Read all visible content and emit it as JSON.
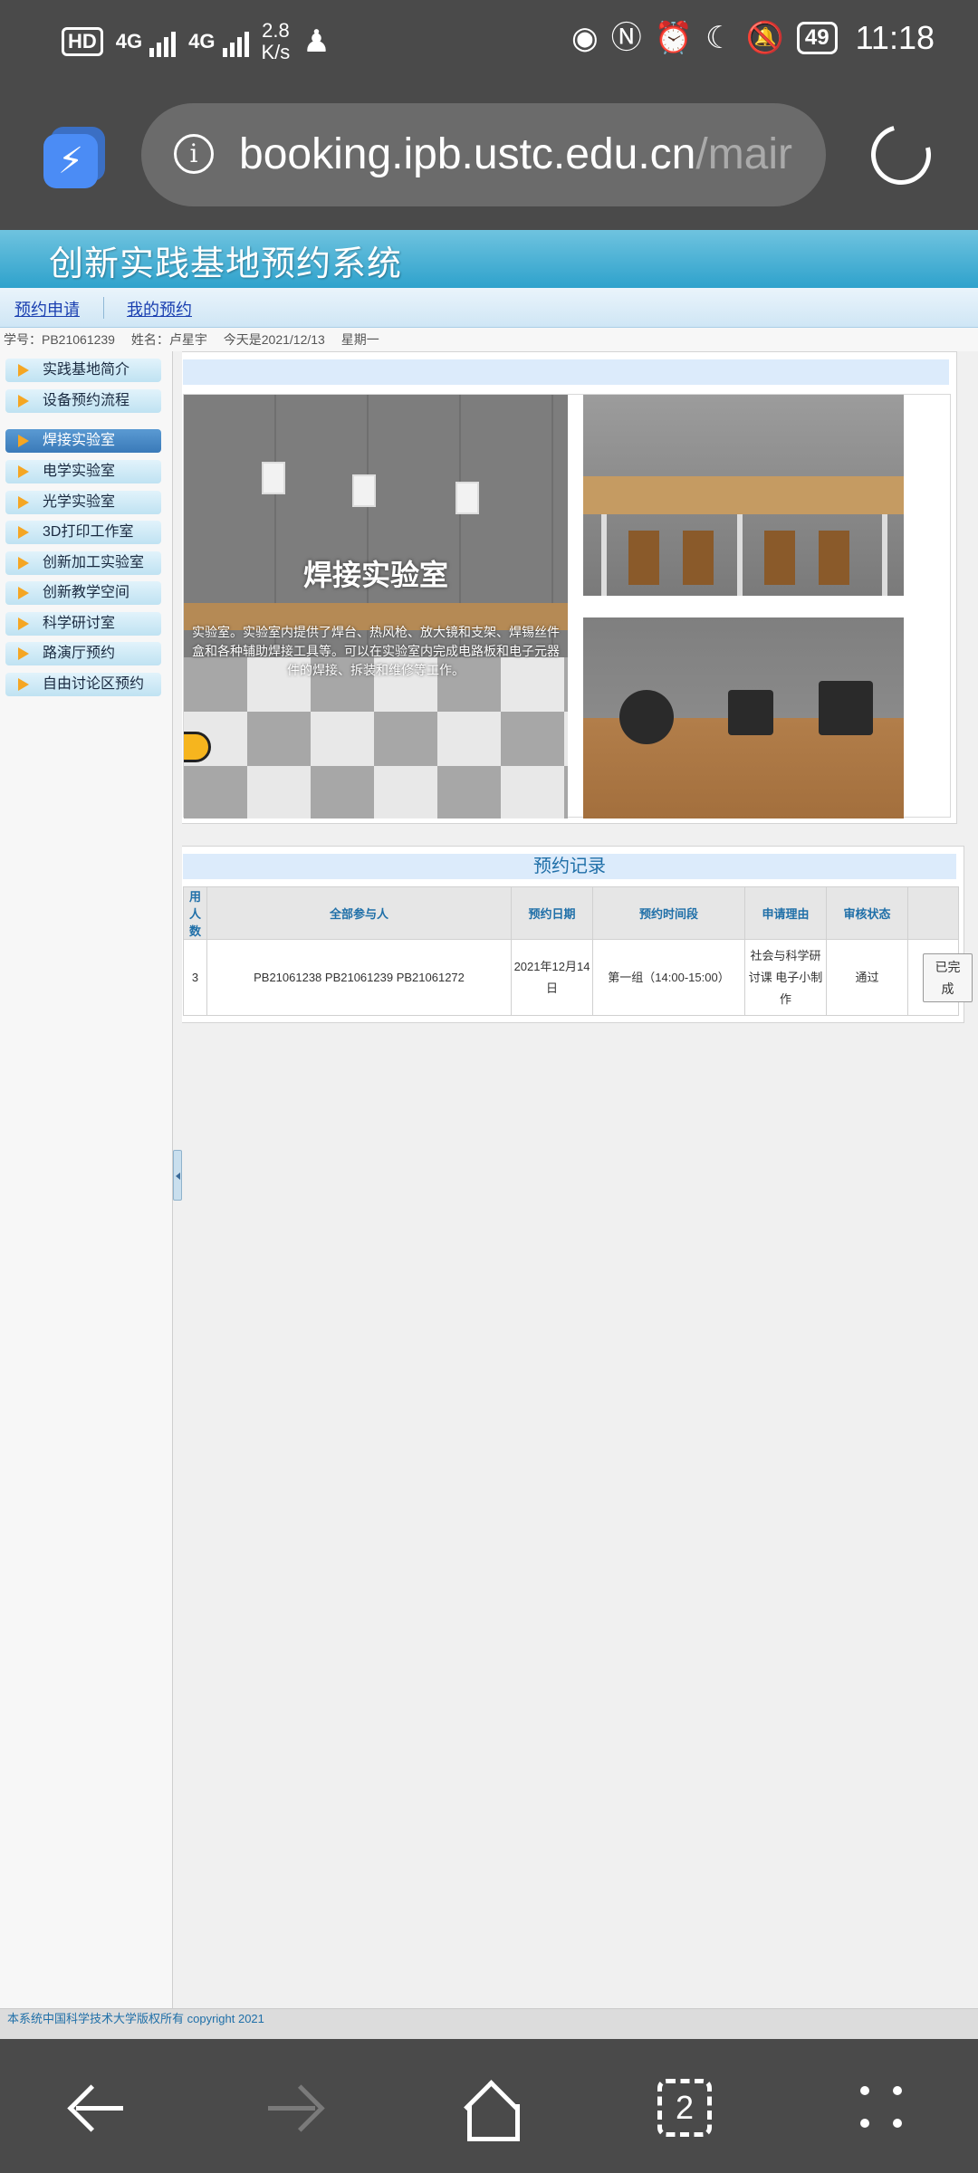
{
  "status_bar": {
    "hd": "HD",
    "sim": "1",
    "net1": "4G",
    "net2": "4G",
    "speed_value": "2.8",
    "speed_unit": "K/s",
    "battery": "49",
    "time": "11:18"
  },
  "browser": {
    "url_main": "booking.ipb.ustc.edu.cn",
    "url_rest": "/mair"
  },
  "site": {
    "title": "创新实践基地预约系统",
    "nav": [
      "预约申请",
      "我的预约"
    ],
    "info": {
      "student_id": "学号：PB21061239",
      "name": "姓名：卢星宇",
      "today": "今天是2021/12/13",
      "weekday": "星期一"
    }
  },
  "sidebar": {
    "items": [
      {
        "label": "实践基地简介",
        "active": false
      },
      {
        "label": "设备预约流程",
        "active": false
      },
      {
        "label": "焊接实验室",
        "active": true
      },
      {
        "label": "电学实验室",
        "active": false
      },
      {
        "label": "光学实验室",
        "active": false
      },
      {
        "label": "3D打印工作室",
        "active": false
      },
      {
        "label": "创新加工实验室",
        "active": false
      },
      {
        "label": "创新教学空间",
        "active": false
      },
      {
        "label": "科学研讨室",
        "active": false
      },
      {
        "label": "路演厅预约",
        "active": false
      },
      {
        "label": "自由讨论区预约",
        "active": false
      }
    ]
  },
  "gallery": {
    "caption": "焊接实验室",
    "description": "实验室。实验室内提供了焊台、热风枪、放大镜和支架、焊锡丝件盒和各种辅助焊接工具等。可以在实验室内完成电路板和电子元器件的焊接、拆装和维修等工作。"
  },
  "records": {
    "title": "预约记录",
    "headers": [
      "用人数",
      "全部参与人",
      "预约日期",
      "预约时间段",
      "申请理由",
      "审核状态",
      ""
    ],
    "rows": [
      {
        "count": "3",
        "participants": "PB21061238 PB21061239 PB21061272",
        "date": "2021年12月14日",
        "slot": "第一组（14:00-15:00）",
        "reason": "社会与科学研讨课 电子小制作",
        "status": "通过",
        "action": "已完成"
      }
    ]
  },
  "footer": "本系统中国科学技术大学版权所有 copyright 2021",
  "bottom_nav": {
    "tab_count": "2"
  },
  "colors": {
    "banner": "#2ea2cc",
    "active_menu": "#3a7ab9",
    "accent_arrow": "#f5a623",
    "link": "#1a3fb0"
  }
}
